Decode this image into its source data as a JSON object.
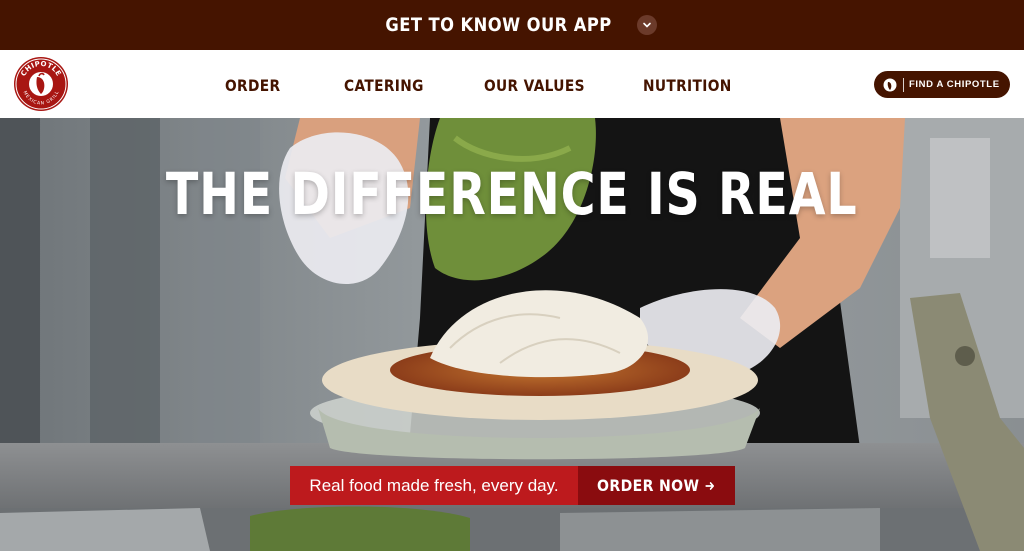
{
  "promo": {
    "text": "GET TO KNOW OUR APP",
    "icon": "chevron-down-icon"
  },
  "nav": {
    "logo": {
      "line1": "CHIPOTLE",
      "line2": "MEXICAN GRILL"
    },
    "links": [
      {
        "label": "ORDER"
      },
      {
        "label": "CATERING"
      },
      {
        "label": "OUR VALUES"
      },
      {
        "label": "NUTRITION"
      }
    ],
    "find_button": {
      "label": "FIND A CHIPOTLE",
      "icon": "chipotle-pepper-icon"
    }
  },
  "hero": {
    "title": "THE DIFFERENCE IS REAL",
    "tagline": "Real food made fresh, every day.",
    "cta_label": "ORDER NOW",
    "cta_icon": "arrow-right-icon"
  },
  "colors": {
    "brand_brown": "#451400",
    "brand_red": "#bd1a1d",
    "cta_dark_red": "#8a0c0f",
    "white": "#ffffff"
  }
}
